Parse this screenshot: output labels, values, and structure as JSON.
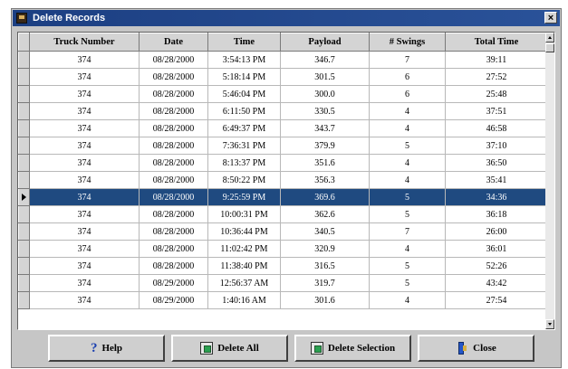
{
  "window": {
    "title": "Delete Records",
    "close_glyph": "×"
  },
  "grid": {
    "columns": [
      "Truck Number",
      "Date",
      "Time",
      "Payload",
      "# Swings",
      "Total Time"
    ],
    "selected_row_index": 8,
    "rows": [
      [
        "374",
        "08/28/2000",
        "3:54:13 PM",
        "346.7",
        "7",
        "39:11"
      ],
      [
        "374",
        "08/28/2000",
        "5:18:14 PM",
        "301.5",
        "6",
        "27:52"
      ],
      [
        "374",
        "08/28/2000",
        "5:46:04 PM",
        "300.0",
        "6",
        "25:48"
      ],
      [
        "374",
        "08/28/2000",
        "6:11:50 PM",
        "330.5",
        "4",
        "37:51"
      ],
      [
        "374",
        "08/28/2000",
        "6:49:37 PM",
        "343.7",
        "4",
        "46:58"
      ],
      [
        "374",
        "08/28/2000",
        "7:36:31 PM",
        "379.9",
        "5",
        "37:10"
      ],
      [
        "374",
        "08/28/2000",
        "8:13:37 PM",
        "351.6",
        "4",
        "36:50"
      ],
      [
        "374",
        "08/28/2000",
        "8:50:22 PM",
        "356.3",
        "4",
        "35:41"
      ],
      [
        "374",
        "08/28/2000",
        "9:25:59 PM",
        "369.6",
        "5",
        "34:36"
      ],
      [
        "374",
        "08/28/2000",
        "10:00:31 PM",
        "362.6",
        "5",
        "36:18"
      ],
      [
        "374",
        "08/28/2000",
        "10:36:44 PM",
        "340.5",
        "7",
        "26:00"
      ],
      [
        "374",
        "08/28/2000",
        "11:02:42 PM",
        "320.9",
        "4",
        "36:01"
      ],
      [
        "374",
        "08/28/2000",
        "11:38:40 PM",
        "316.5",
        "5",
        "52:26"
      ],
      [
        "374",
        "08/29/2000",
        "12:56:37 AM",
        "319.7",
        "5",
        "43:42"
      ],
      [
        "374",
        "08/29/2000",
        "1:40:16 AM",
        "301.6",
        "4",
        "27:54"
      ]
    ]
  },
  "buttons": {
    "help": "Help",
    "delete_all": "Delete All",
    "delete_selection": "Delete Selection",
    "close": "Close"
  },
  "colors": {
    "title_bar": "#1c3f82",
    "selection": "#1f4a80"
  }
}
